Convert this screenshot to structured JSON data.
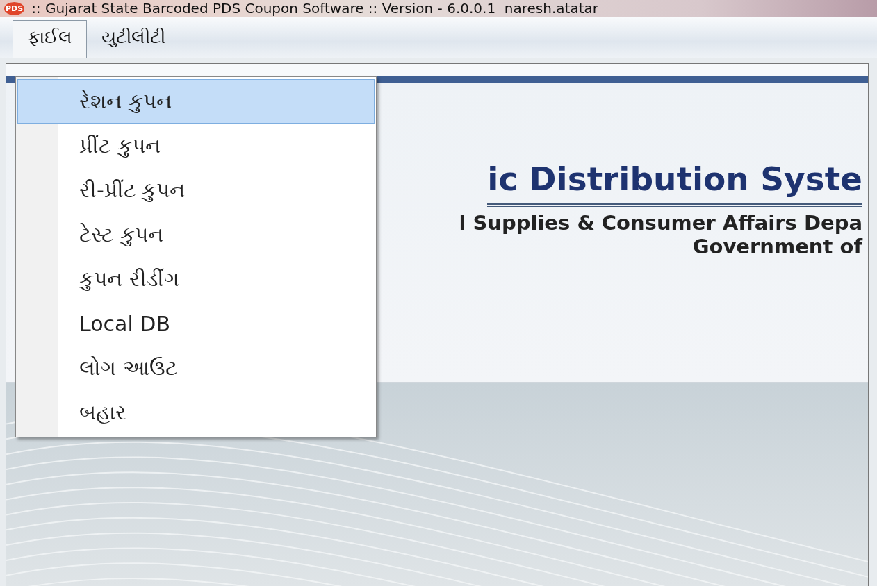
{
  "window": {
    "icon_label": "PDS",
    "title": ":: Gujarat State Barcoded PDS Coupon Software :: Version - 6.0.0.1  naresh.atatar"
  },
  "menubar": [
    {
      "label": "ફાઈલ",
      "selected": true
    },
    {
      "label": "યુટીલીટી",
      "selected": false
    }
  ],
  "dropdown": {
    "items": [
      {
        "label": "રેશન કુપન",
        "selected": true
      },
      {
        "label": "પ્રીંટ કુપન",
        "selected": false
      },
      {
        "label": "રી-પ્રીંટ કુપન",
        "selected": false
      },
      {
        "label": "ટેસ્ટ કુપન",
        "selected": false
      },
      {
        "label": "કુપન રીડીંગ",
        "selected": false
      },
      {
        "label": "Local DB",
        "selected": false
      },
      {
        "label": "લોગ આઉટ",
        "selected": false
      },
      {
        "label": "બહાર",
        "selected": false
      }
    ]
  },
  "banner": {
    "title": "ic Distribution Syste",
    "department": "l Supplies & Consumer Affairs Depa",
    "government": "Government of"
  }
}
